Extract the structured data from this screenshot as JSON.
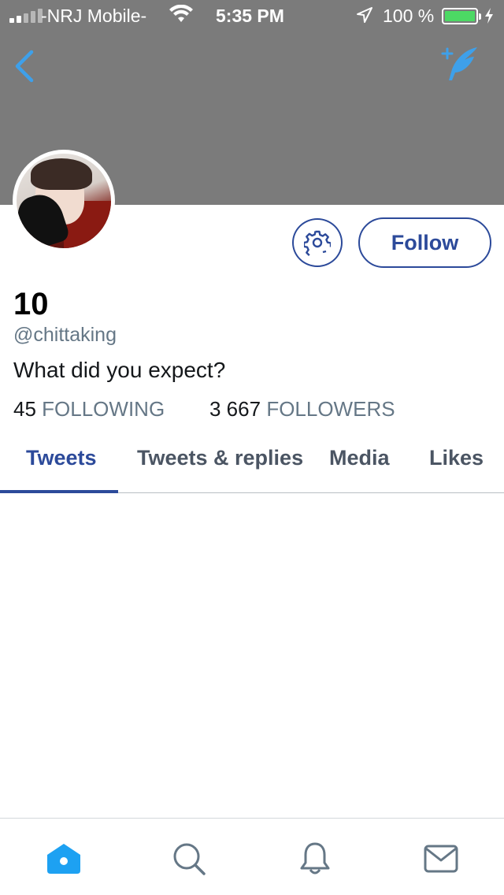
{
  "status_bar": {
    "carrier": "-NRJ Mobile-",
    "time": "5:35 PM",
    "battery": "100 %"
  },
  "nav": {
    "back_icon": "chevron-left-icon",
    "compose_icon": "feather-compose-icon"
  },
  "profile": {
    "display_name": "10",
    "handle": "@chittaking",
    "bio": "What did you expect?",
    "following_count": "45",
    "following_label": "FOLLOWING",
    "followers_count": "3 667",
    "followers_label": "FOLLOWERS"
  },
  "actions": {
    "follow_label": "Follow",
    "settings_icon": "gear-icon"
  },
  "tabs": [
    {
      "label": "Tweets",
      "active": true
    },
    {
      "label": "Tweets & replies",
      "active": false
    },
    {
      "label": "Media",
      "active": false
    },
    {
      "label": "Likes",
      "active": false
    }
  ],
  "tabbar": [
    {
      "icon": "home-icon",
      "active": true
    },
    {
      "icon": "search-icon",
      "active": false
    },
    {
      "icon": "bell-icon",
      "active": false
    },
    {
      "icon": "mail-icon",
      "active": false
    }
  ],
  "colors": {
    "accent": "#2c4a9a",
    "twitter_blue": "#1da1f2",
    "muted_text": "#657786",
    "battery_green": "#4cd964",
    "header_gray": "#7b7b7b"
  }
}
